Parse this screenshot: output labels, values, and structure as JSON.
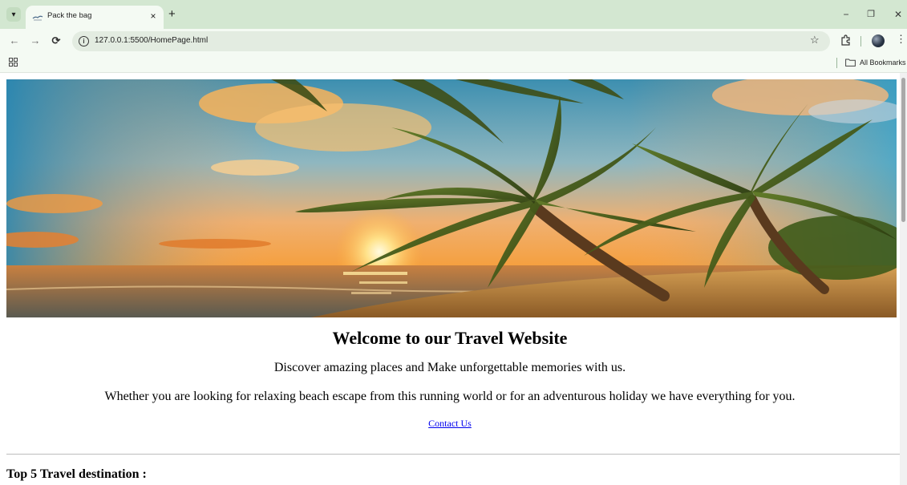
{
  "browser": {
    "tab_title": "Pack the bag",
    "tab_close": "×",
    "new_tab": "+",
    "url": "127.0.0.1:5500/HomePage.html",
    "bookmarks_label": "All Bookmarks",
    "window_controls": {
      "minimize": "−",
      "restore": "❐",
      "close": "✕"
    },
    "nav": {
      "back": "←",
      "forward": "→",
      "reload": "⟳"
    },
    "icons": {
      "tab_menu": "chevron-down-icon",
      "favicon": "bird-favicon-icon",
      "info": "info-icon",
      "star": "bookmark-star-icon",
      "extensions": "puzzle-icon",
      "profile": "avatar",
      "menu": "kebab-menu-icon",
      "apps": "apps-grid-icon",
      "folder": "folder-icon"
    },
    "colors": {
      "chrome": "#d3e7d1",
      "toolbar": "#f4faf3",
      "omnibox": "#e3ece1"
    }
  },
  "page": {
    "heading": "Welcome to our Travel Website",
    "paragraph1": "Discover amazing places and Make unforgettable memories with us.",
    "paragraph2": "Whether you are looking for relaxing beach escape from this running world or for an adventurous holiday we have everything for you.",
    "contact_link": "Contact Us",
    "section_heading": "Top 5 Travel destination :",
    "link_color": "#0000ee"
  }
}
